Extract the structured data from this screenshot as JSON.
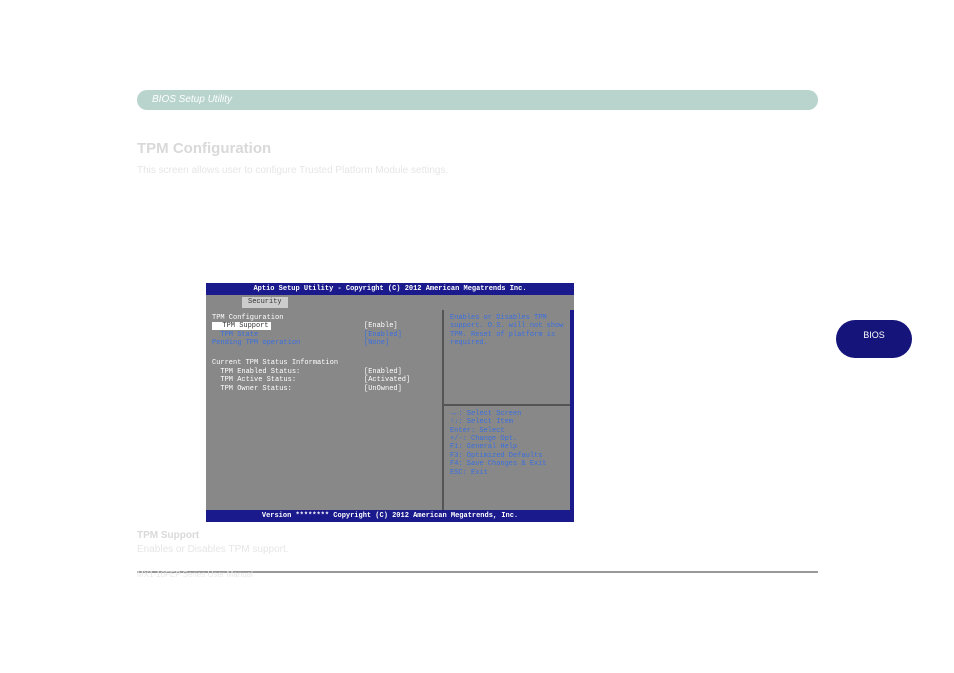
{
  "page": {
    "header": "BIOS Setup Utility",
    "title": "TPM Configuration",
    "desc1": "This screen allows user to configure Trusted Platform Module settings.",
    "desc2": ""
  },
  "bios": {
    "title": "Aptio Setup Utility - Copyright (C) 2012 American Megatrends Inc.",
    "tab": "Security",
    "left": {
      "section1": "TPM Configuration",
      "items": [
        {
          "label": "  TPM Support",
          "value": "[Enable]",
          "selected": true
        },
        {
          "label": "  TPM State",
          "value": "[Enabled]",
          "selected": false
        },
        {
          "label": "Pending TPM operation",
          "value": "[None]",
          "selected": false
        }
      ],
      "section2": "Current TPM Status Information",
      "status": [
        {
          "label": "  TPM Enabled Status:",
          "value": "[Enabled]"
        },
        {
          "label": "  TPM Active Status:",
          "value": "[Activated]"
        },
        {
          "label": "  TPM Owner Status:",
          "value": "[UnOwned]"
        }
      ]
    },
    "help": {
      "l1": "Enables or Disables TPM",
      "l2": "support. O.S. will not show",
      "l3": "TPM. Reset of platform is",
      "l4": "required."
    },
    "keys": {
      "k1": "→←: Select Screen",
      "k2": "↑↓: Select Item",
      "k3": "Enter: Select",
      "k4": "+/-: Change Opt.",
      "k5": "F1: General Help",
      "k6": "F3: Optimized Defaults",
      "k7": "F4: Save Changes & Exit",
      "k8": "ESC: Exit"
    },
    "footer": "Version ******** Copyright (C) 2012 American Megatrends, Inc."
  },
  "badge": "BIOS",
  "opt1": {
    "name": "TPM Support",
    "desc": "Enables or Disables TPM support."
  },
  "footer": {
    "c1": "MX1-10FEP Series User Manual",
    "c2": "",
    "c3": ""
  }
}
